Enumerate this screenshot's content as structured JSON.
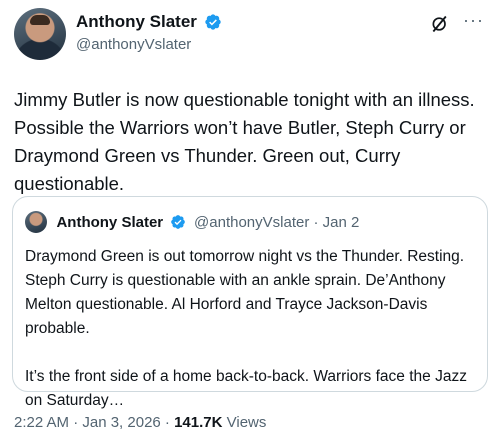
{
  "author": {
    "display_name": "Anthony Slater",
    "handle": "@anthonyVslater"
  },
  "tweet": {
    "text": "Jimmy Butler is now questionable tonight with an illness. Possible the Warriors won’t have Butler, Steph Curry or Draymond Green vs Thunder. Green out, Curry questionable."
  },
  "quoted": {
    "display_name": "Anthony Slater",
    "handle_date": "@anthonyVslater · Jan 2",
    "paragraph1": "Draymond Green is out tomorrow night vs the Thunder. Resting. Steph Curry is questionable with an ankle sprain. De’Anthony Melton questionable. Al Horford and Trayce Jackson-Davis probable.",
    "paragraph2": "It’s the front side of a home back-to-back. Warriors face the Jazz on Saturday…"
  },
  "meta": {
    "timestamp": "2:22 AM · Jan 3, 2026 · ",
    "views_count": "141.7K",
    "views_label": " Views"
  },
  "icons": {
    "verified": "verified-badge-icon",
    "grok": "grok-icon",
    "more": "more-icon"
  },
  "colors": {
    "verified_blue": "#1d9bf0",
    "secondary_text": "#536471",
    "border": "#cfd9de"
  }
}
